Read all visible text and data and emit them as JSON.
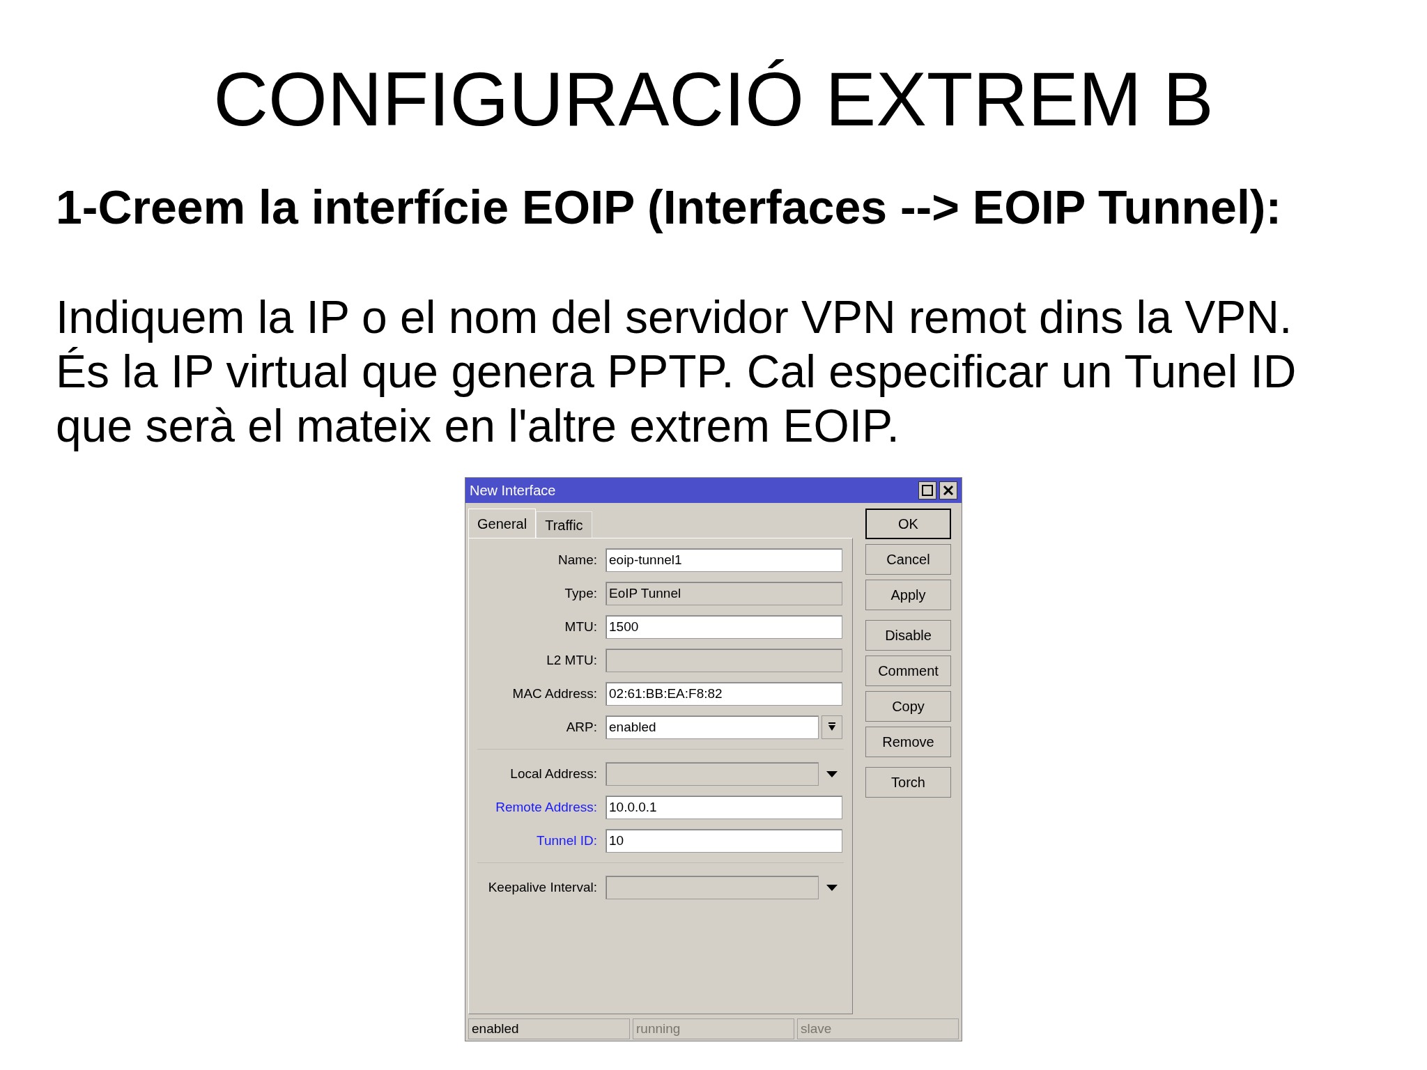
{
  "slide": {
    "title": "CONFIGURACIÓ EXTREM B",
    "heading": "1-Creem la interfície EOIP (Interfaces --> EOIP Tunnel):",
    "paragraph": "Indiquem la IP o el nom del servidor VPN remot dins la VPN. És la IP virtual que genera PPTP. Cal especificar un Tunel ID que serà el mateix en l'altre extrem EOIP."
  },
  "window": {
    "title": "New Interface",
    "tabs": [
      {
        "label": "General",
        "selected": true
      },
      {
        "label": "Traffic",
        "selected": false
      }
    ],
    "groups": [
      [
        {
          "label": "Name:",
          "value": "eoip-tunnel1",
          "kind": "text",
          "required": false
        },
        {
          "label": "Type:",
          "value": "EoIP Tunnel",
          "kind": "readonly",
          "required": false
        },
        {
          "label": "MTU:",
          "value": "1500",
          "kind": "text",
          "required": false
        },
        {
          "label": "L2 MTU:",
          "kind": "readonly",
          "required": false
        },
        {
          "label": "MAC Address:",
          "value": "02:61:BB:EA:F8:82",
          "kind": "text",
          "required": false
        },
        {
          "label": "ARP:",
          "value": "enabled",
          "kind": "select",
          "required": false
        }
      ],
      [
        {
          "label": "Local Address:",
          "kind": "combo",
          "required": false
        },
        {
          "label": "Remote Address:",
          "value": "10.0.0.1",
          "kind": "text",
          "required": true
        },
        {
          "label": "Tunnel ID:",
          "value": "10",
          "kind": "text",
          "required": true
        }
      ],
      [
        {
          "label": "Keepalive Interval:",
          "kind": "combo",
          "required": false
        }
      ]
    ],
    "button_groups": [
      [
        "OK",
        "Cancel",
        "Apply"
      ],
      [
        "Disable",
        "Comment",
        "Copy",
        "Remove"
      ],
      [
        "Torch"
      ]
    ],
    "status_bar": [
      {
        "text": "enabled",
        "disabled": false
      },
      {
        "text": "running",
        "disabled": true
      },
      {
        "text": "slave",
        "disabled": true
      }
    ]
  }
}
